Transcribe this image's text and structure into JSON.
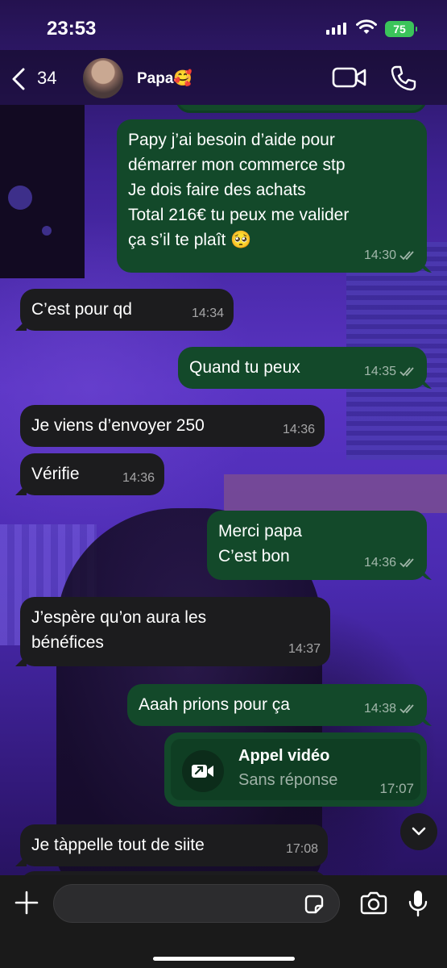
{
  "status": {
    "time": "23:53",
    "battery": "75"
  },
  "header": {
    "back_count": "34",
    "contact_name": "Papa🥰"
  },
  "messages": [
    {
      "dir": "out",
      "text": "Papy j’ai besoin d’aide pour\ndémarrer mon commerce stp\nJe dois faire des achats\nTotal 216€ tu peux me valider\nça s’il te plaît 🥺",
      "time": "14:30",
      "read": true
    },
    {
      "dir": "in",
      "text": "C’est pour qd",
      "time": "14:34"
    },
    {
      "dir": "out",
      "text": "Quand tu peux",
      "time": "14:35",
      "read": true
    },
    {
      "dir": "in",
      "text": "Je viens d’envoyer 250",
      "time": "14:36"
    },
    {
      "dir": "in",
      "text": "Vérifie",
      "time": "14:36"
    },
    {
      "dir": "out",
      "text": "Merci papa\nC’est bon",
      "time": "14:36",
      "read": true
    },
    {
      "dir": "in",
      "text": "J’espère qu’on aura les\nbénéfices",
      "time": "14:37"
    },
    {
      "dir": "out",
      "text": "Aaah prions pour ça",
      "time": "14:38",
      "read": true
    },
    {
      "dir": "in",
      "text": "Je tàppelle tout de siite",
      "time": "17:08"
    }
  ],
  "call": {
    "title": "Appel vidéo",
    "subtitle": "Sans réponse",
    "time": "17:07"
  },
  "input": {
    "placeholder": ""
  },
  "colors": {
    "outgoing_bubble": "#13492a",
    "incoming_bubble": "#1c1c1e",
    "battery": "#3bc45a"
  },
  "icons": [
    "chevron-left-icon",
    "video-camera-icon",
    "phone-icon",
    "plus-icon",
    "sticker-icon",
    "camera-icon",
    "microphone-icon",
    "chevron-down-icon",
    "missed-video-call-icon",
    "double-check-icon"
  ]
}
